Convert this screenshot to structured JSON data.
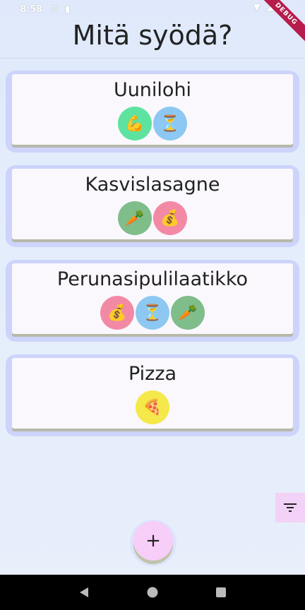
{
  "status_bar": {
    "time": "8:58",
    "left_icons": [
      "gear-icon",
      "sd-card-icon"
    ],
    "right_icons": [
      "wifi-icon",
      "signal-icon",
      "battery-icon"
    ]
  },
  "debug_banner": "DEBUG",
  "app": {
    "title": "Mitä syödä?"
  },
  "meals": [
    {
      "name": "Uunilohi",
      "tags": [
        {
          "icon": "flexed-biceps-icon",
          "glyph": "💪",
          "color": "#5de39f"
        },
        {
          "icon": "hourglass-icon",
          "glyph": "⏳",
          "color": "#8cc8f2"
        }
      ]
    },
    {
      "name": "Kasvislasagne",
      "tags": [
        {
          "icon": "carrot-icon",
          "glyph": "🥕",
          "color": "#7fbd8a"
        },
        {
          "icon": "money-bag-icon",
          "glyph": "💰",
          "color": "#f28aa6"
        }
      ]
    },
    {
      "name": "Perunasipulilaatikko",
      "tags": [
        {
          "icon": "money-bag-icon",
          "glyph": "💰",
          "color": "#f28aa6"
        },
        {
          "icon": "hourglass-icon",
          "glyph": "⏳",
          "color": "#8cc8f2"
        },
        {
          "icon": "carrot-icon",
          "glyph": "🥕",
          "color": "#7fbd8a"
        }
      ]
    },
    {
      "name": "Pizza",
      "tags": [
        {
          "icon": "pizza-icon",
          "glyph": "🍕",
          "color": "#f5e84a"
        }
      ]
    }
  ],
  "fab": {
    "label": "+"
  },
  "filter": {
    "icon": "filter-icon"
  },
  "colors": {
    "card_wrap": "#ccd4fb",
    "card": "#faf8fd",
    "fab": "#f6cef7",
    "filter": "#f3d2f7"
  }
}
